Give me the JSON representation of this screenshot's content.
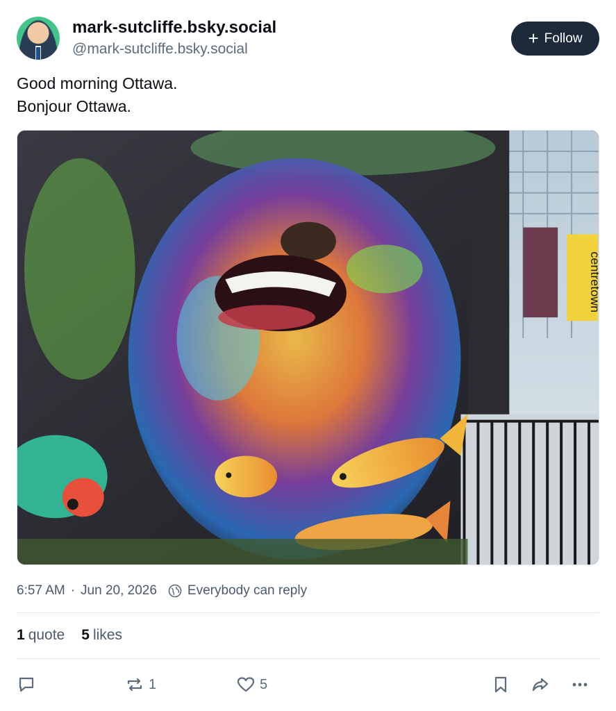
{
  "author": {
    "display_name": "mark-sutcliffe.bsky.social",
    "handle": "@mark-sutcliffe.bsky.social"
  },
  "follow_button": {
    "label": "Follow",
    "icon": "plus-icon"
  },
  "post": {
    "lines": [
      "Good morning Ottawa.",
      "Bonjour Ottawa."
    ],
    "image": {
      "banner_text": "centretown"
    }
  },
  "meta": {
    "time": "6:57 AM",
    "separator": "·",
    "date": "Jun 20, 2026",
    "reply_setting": "Everybody can reply"
  },
  "stats": {
    "quotes_count": "1",
    "quotes_label": "quote",
    "likes_count": "5",
    "likes_label": "likes"
  },
  "actions": {
    "reply": {
      "icon": "reply-icon",
      "count": ""
    },
    "repost": {
      "icon": "repost-icon",
      "count": "1"
    },
    "like": {
      "icon": "heart-icon",
      "count": "5"
    },
    "bookmark": {
      "icon": "bookmark-icon"
    },
    "share": {
      "icon": "share-icon"
    },
    "more": {
      "icon": "more-icon"
    }
  },
  "colors": {
    "follow_bg": "#1d2a3a",
    "muted_text": "#5b6b7c",
    "divider": "#e3e7ec"
  }
}
